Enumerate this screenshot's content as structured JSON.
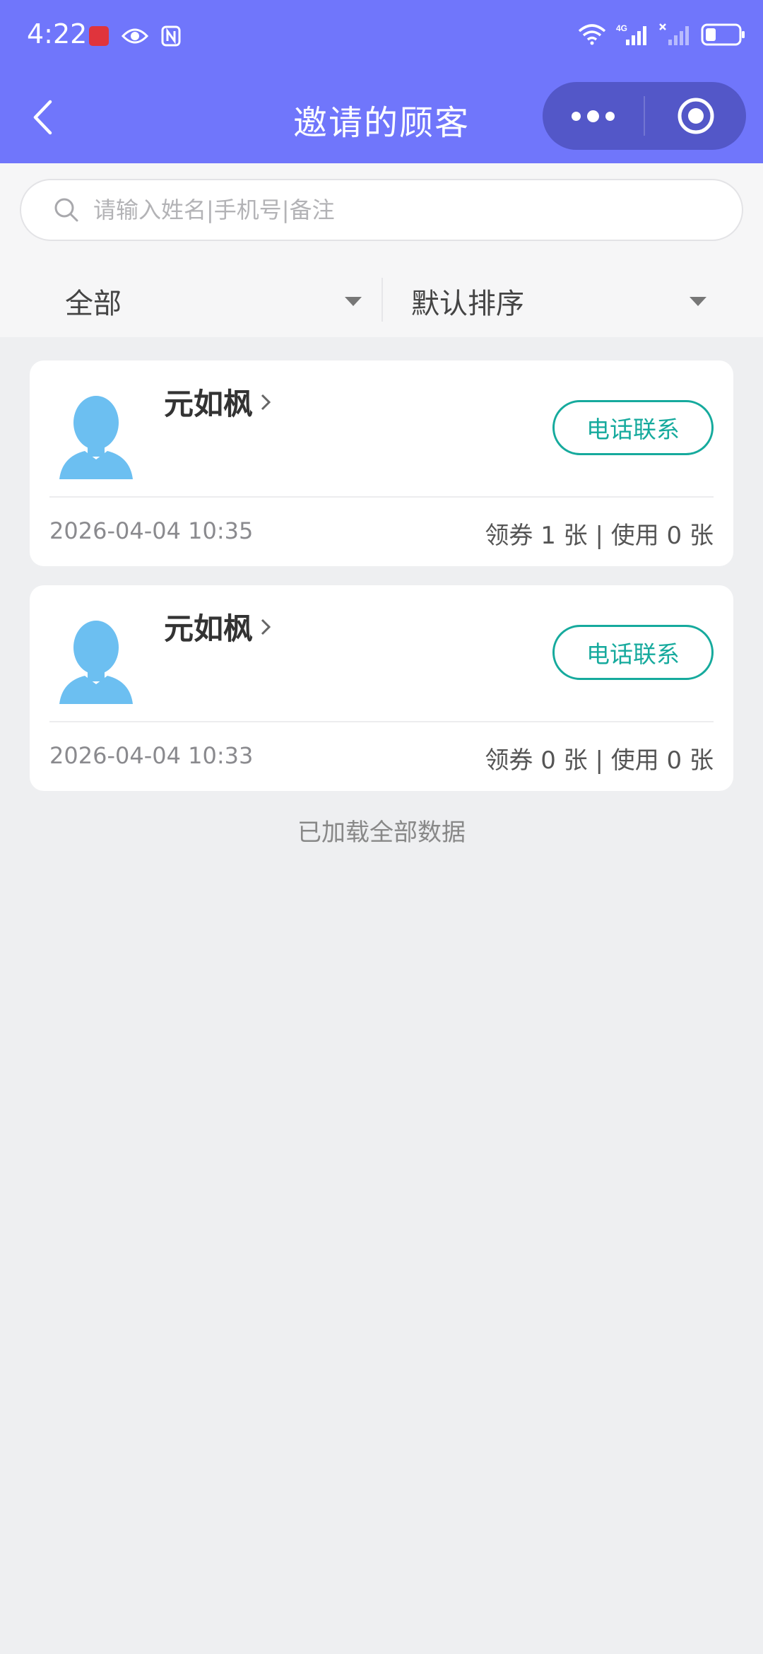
{
  "status_bar": {
    "time": "4:22",
    "left_icons": [
      "app-notification-icon",
      "eye-icon",
      "nfc-icon"
    ],
    "right_icons": [
      "wifi-icon",
      "signal-4g-icon",
      "signal-no-service-icon",
      "battery-icon"
    ],
    "network_label": "4G"
  },
  "nav": {
    "title": "邀请的顾客",
    "back_icon": "chevron-left-icon",
    "more_icon": "more-dots-icon",
    "close_icon": "target-circle-icon"
  },
  "search": {
    "placeholder": "请输入姓名|手机号|备注",
    "value": "",
    "icon": "search-icon"
  },
  "filters": {
    "category": "全部",
    "sort": "默认排序"
  },
  "customers": [
    {
      "name": "元如枫",
      "call_label": "电话联系",
      "date": "2026-04-04 10:35",
      "stats": "领券 1 张 | 使用 0 张"
    },
    {
      "name": "元如枫",
      "call_label": "电话联系",
      "date": "2026-04-04 10:33",
      "stats": "领券 0 张 | 使用 0 张"
    }
  ],
  "footer": {
    "loaded_text": "已加载全部数据"
  },
  "colors": {
    "header": "#7076fb",
    "capsule": "#5357c8",
    "accent_teal": "#16aa9d",
    "avatar": "#6cbff1",
    "page_bg": "#eeeff1"
  }
}
